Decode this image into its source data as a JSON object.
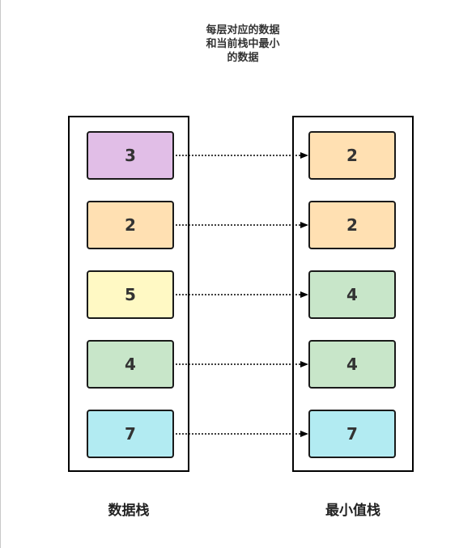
{
  "title": "每层对应的数据\n和当前栈中最小\n的数据",
  "data_stack": {
    "label": "数据栈",
    "cells": [
      {
        "value": "3",
        "color": "#e1bee7"
      },
      {
        "value": "2",
        "color": "#ffe0b2"
      },
      {
        "value": "5",
        "color": "#fff9c4"
      },
      {
        "value": "4",
        "color": "#c8e6c9"
      },
      {
        "value": "7",
        "color": "#b2ebf2"
      }
    ]
  },
  "min_stack": {
    "label": "最小值栈",
    "cells": [
      {
        "value": "2",
        "color": "#ffe0b2"
      },
      {
        "value": "2",
        "color": "#ffe0b2"
      },
      {
        "value": "4",
        "color": "#c8e6c9"
      },
      {
        "value": "4",
        "color": "#c8e6c9"
      },
      {
        "value": "7",
        "color": "#b2ebf2"
      }
    ]
  }
}
